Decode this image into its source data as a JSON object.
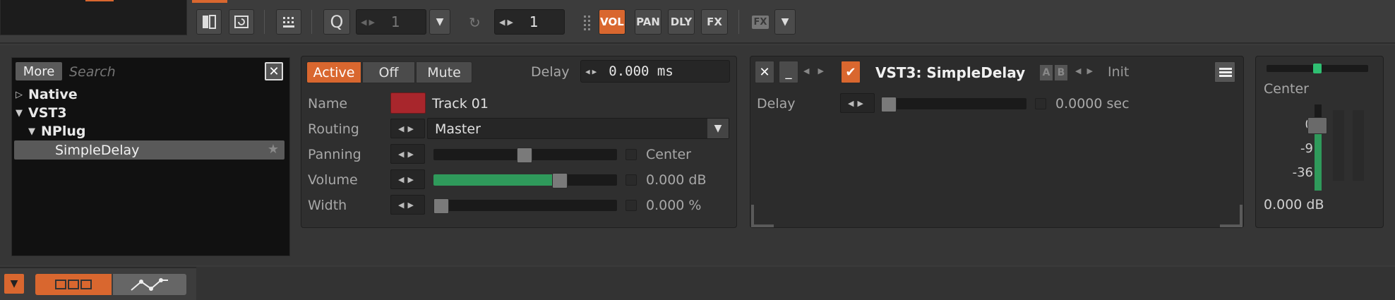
{
  "toolbar": {
    "quantize_label": "Q",
    "quantize_value": "1",
    "repeat_value": "1",
    "modes": [
      "VOL",
      "PAN",
      "DLY",
      "FX"
    ],
    "fx_small": "FX",
    "accent_color": "#d9672f"
  },
  "browser": {
    "more_label": "More",
    "search_placeholder": "Search",
    "tree": [
      {
        "label": "Native",
        "expanded": false
      },
      {
        "label": "VST3",
        "expanded": true
      },
      {
        "label": "NPlug",
        "expanded": true
      },
      {
        "label": "SimpleDelay",
        "selected": true
      }
    ]
  },
  "inspector": {
    "active_label": "Active",
    "off_label": "Off",
    "mute_label": "Mute",
    "delay_label": "Delay",
    "delay_value": "0.000 ms",
    "name_label": "Name",
    "name_value": "Track 01",
    "track_color": "#a8262c",
    "routing_label": "Routing",
    "routing_value": "Master",
    "panning_label": "Panning",
    "panning_value": "Center",
    "panning_fraction": 0.5,
    "volume_label": "Volume",
    "volume_value": "0.000 dB",
    "volume_fraction": 0.7,
    "width_label": "Width",
    "width_value": "0.000 %",
    "width_fraction": 0.0
  },
  "device": {
    "title": "VST3: SimpleDelay",
    "ab_a": "A",
    "ab_b": "B",
    "preset": "Init",
    "param_label": "Delay",
    "param_value": "0.0000 sec",
    "param_fraction": 0.0
  },
  "meter": {
    "pan_label": "Center",
    "scale": [
      "0",
      "-9",
      "-36"
    ],
    "value": "0.000 dB"
  }
}
